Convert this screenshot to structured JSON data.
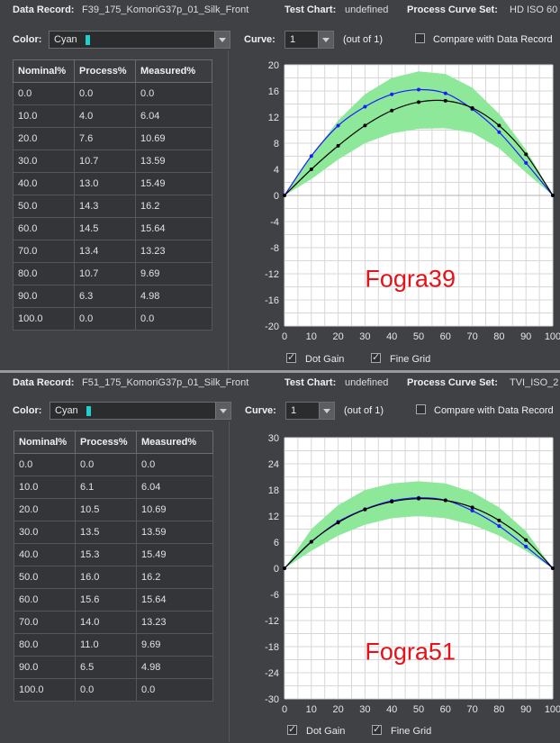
{
  "panels": [
    {
      "record_label": "Data Record:",
      "record_value": "F39_175_KomoriG37p_01_Silk_Front",
      "chart_label": "Test Chart:",
      "chart_value": "undefined",
      "curveset_label": "Process Curve Set:",
      "curveset_value": "HD ISO 60",
      "color_label": "Color:",
      "color_value": "Cyan",
      "curve_label": "Curve:",
      "curve_value": "1",
      "out_of": "(out of 1)",
      "compare_label": "Compare with Data Record",
      "table": {
        "headers": [
          "Nominal%",
          "Process%",
          "Measured%"
        ],
        "rows": [
          [
            "0.0",
            "0.0",
            "0.0"
          ],
          [
            "10.0",
            "4.0",
            "6.04"
          ],
          [
            "20.0",
            "7.6",
            "10.69"
          ],
          [
            "30.0",
            "10.7",
            "13.59"
          ],
          [
            "40.0",
            "13.0",
            "15.49"
          ],
          [
            "50.0",
            "14.3",
            "16.2"
          ],
          [
            "60.0",
            "14.5",
            "15.64"
          ],
          [
            "70.0",
            "13.4",
            "13.23"
          ],
          [
            "80.0",
            "10.7",
            "9.69"
          ],
          [
            "90.0",
            "6.3",
            "4.98"
          ],
          [
            "100.0",
            "0.0",
            "0.0"
          ]
        ]
      },
      "dot_gain_label": "Dot Gain",
      "fine_grid_label": "Fine Grid",
      "chart_title": "Fogra39",
      "chart_data": {
        "type": "line",
        "x": [
          0,
          10,
          20,
          30,
          40,
          50,
          60,
          70,
          80,
          90,
          100
        ],
        "ylim": [
          -20,
          20
        ],
        "yticks": [
          20,
          16,
          12,
          8,
          4,
          0,
          -4,
          -8,
          -12,
          -16,
          -20
        ],
        "xticks": [
          0,
          10,
          20,
          30,
          40,
          50,
          60,
          70,
          80,
          90,
          100
        ],
        "series": [
          {
            "values": [
              0,
              6.04,
              10.69,
              13.59,
              15.49,
              16.2,
              15.64,
              13.23,
              9.69,
              4.98,
              0
            ],
            "color": "#1a1aff"
          },
          {
            "values": [
              0,
              4.0,
              7.6,
              10.7,
              13.0,
              14.3,
              14.5,
              13.4,
              10.7,
              6.3,
              0
            ],
            "color": "#000000"
          }
        ],
        "band_upper": [
          0,
          6,
          11.5,
          15.5,
          18,
          19,
          18.6,
          16.5,
          12.5,
          7,
          0
        ],
        "band_lower": [
          0,
          2.5,
          5.5,
          8,
          9.5,
          10.2,
          10.3,
          9.6,
          7.2,
          3.5,
          0
        ],
        "band_color": "#8de89a"
      }
    },
    {
      "record_label": "Data Record:",
      "record_value": "F51_175_KomoriG37p_01_Silk_Front",
      "chart_label": "Test Chart:",
      "chart_value": "undefined",
      "curveset_label": "Process Curve Set:",
      "curveset_value": "TVI_ISO_2",
      "color_label": "Color:",
      "color_value": "Cyan",
      "curve_label": "Curve:",
      "curve_value": "1",
      "out_of": "(out of 1)",
      "compare_label": "Compare with Data Record",
      "table": {
        "headers": [
          "Nominal%",
          "Process%",
          "Measured%"
        ],
        "rows": [
          [
            "0.0",
            "0.0",
            "0.0"
          ],
          [
            "10.0",
            "6.1",
            "6.04"
          ],
          [
            "20.0",
            "10.5",
            "10.69"
          ],
          [
            "30.0",
            "13.5",
            "13.59"
          ],
          [
            "40.0",
            "15.3",
            "15.49"
          ],
          [
            "50.0",
            "16.0",
            "16.2"
          ],
          [
            "60.0",
            "15.6",
            "15.64"
          ],
          [
            "70.0",
            "14.0",
            "13.23"
          ],
          [
            "80.0",
            "11.0",
            "9.69"
          ],
          [
            "90.0",
            "6.5",
            "4.98"
          ],
          [
            "100.0",
            "0.0",
            "0.0"
          ]
        ]
      },
      "dot_gain_label": "Dot Gain",
      "fine_grid_label": "Fine Grid",
      "chart_title": "Fogra51",
      "chart_data": {
        "type": "line",
        "x": [
          0,
          10,
          20,
          30,
          40,
          50,
          60,
          70,
          80,
          90,
          100
        ],
        "ylim": [
          -30,
          30
        ],
        "yticks": [
          30,
          24,
          18,
          12,
          6,
          0,
          -6,
          -12,
          -18,
          -24,
          -30
        ],
        "xticks": [
          0,
          10,
          20,
          30,
          40,
          50,
          60,
          70,
          80,
          90,
          100
        ],
        "series": [
          {
            "values": [
              0,
              6.04,
              10.69,
              13.59,
              15.49,
              16.2,
              15.64,
              13.23,
              9.69,
              4.98,
              0
            ],
            "color": "#1a1aff"
          },
          {
            "values": [
              0,
              6.1,
              10.5,
              13.5,
              15.3,
              16.0,
              15.6,
              14.0,
              11.0,
              6.5,
              0
            ],
            "color": "#000000"
          }
        ],
        "band_upper": [
          0,
          9,
          14.5,
          18,
          19.5,
          20,
          19.5,
          17.5,
          14,
          8.5,
          0
        ],
        "band_lower": [
          0,
          4,
          7.5,
          10,
          11.5,
          12,
          11.5,
          10,
          7.5,
          4,
          0
        ],
        "band_color": "#8de89a"
      }
    }
  ]
}
